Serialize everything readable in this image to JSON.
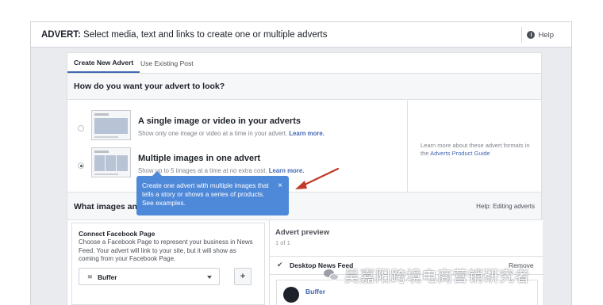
{
  "header": {
    "label_bold": "ADVERT:",
    "label_rest": " Select media, text and links to create one or multiple adverts",
    "help_label": "Help"
  },
  "tabs": [
    {
      "label": "Create New Advert",
      "active": true
    },
    {
      "label": "Use Existing Post",
      "active": false
    }
  ],
  "format_section": {
    "heading": "How do you want your advert to look?",
    "options": [
      {
        "title": "A single image or video in your adverts",
        "description": "Show only one image or video at a time in your advert.",
        "link": "Learn more.",
        "selected": false
      },
      {
        "title": "Multiple images in one advert",
        "description": "Show up to 5 images at a time at no extra cost.",
        "link": "Learn more.",
        "selected": true
      }
    ],
    "side_info": {
      "text": "Learn more about these advert formats in the ",
      "link": "Adverts Product Guide"
    }
  },
  "tooltip": {
    "text": "Create one advert with multiple images that tells a story or shows a series of products. See examples.",
    "close": "×"
  },
  "images_section": {
    "heading_visible": "What images and",
    "help_link": "Help: Editing adverts"
  },
  "connect_page": {
    "heading": "Connect Facebook Page",
    "description": "Choose a Facebook Page to represent your business in News Feed. Your advert will link to your site, but it will show as coming from your Facebook Page.",
    "selected_page": "Buffer",
    "add_label": "+"
  },
  "preview": {
    "title": "Advert preview",
    "count": "1 of 1",
    "placement": "Desktop News Feed",
    "remove_label": "Remove",
    "page_name": "Buffer"
  },
  "watermark": {
    "text": "吴嘉阳跨境电商营销研究者"
  },
  "colors": {
    "accent": "#4267b2",
    "tooltip": "#4e88d8",
    "arrow": "#c0392b"
  }
}
